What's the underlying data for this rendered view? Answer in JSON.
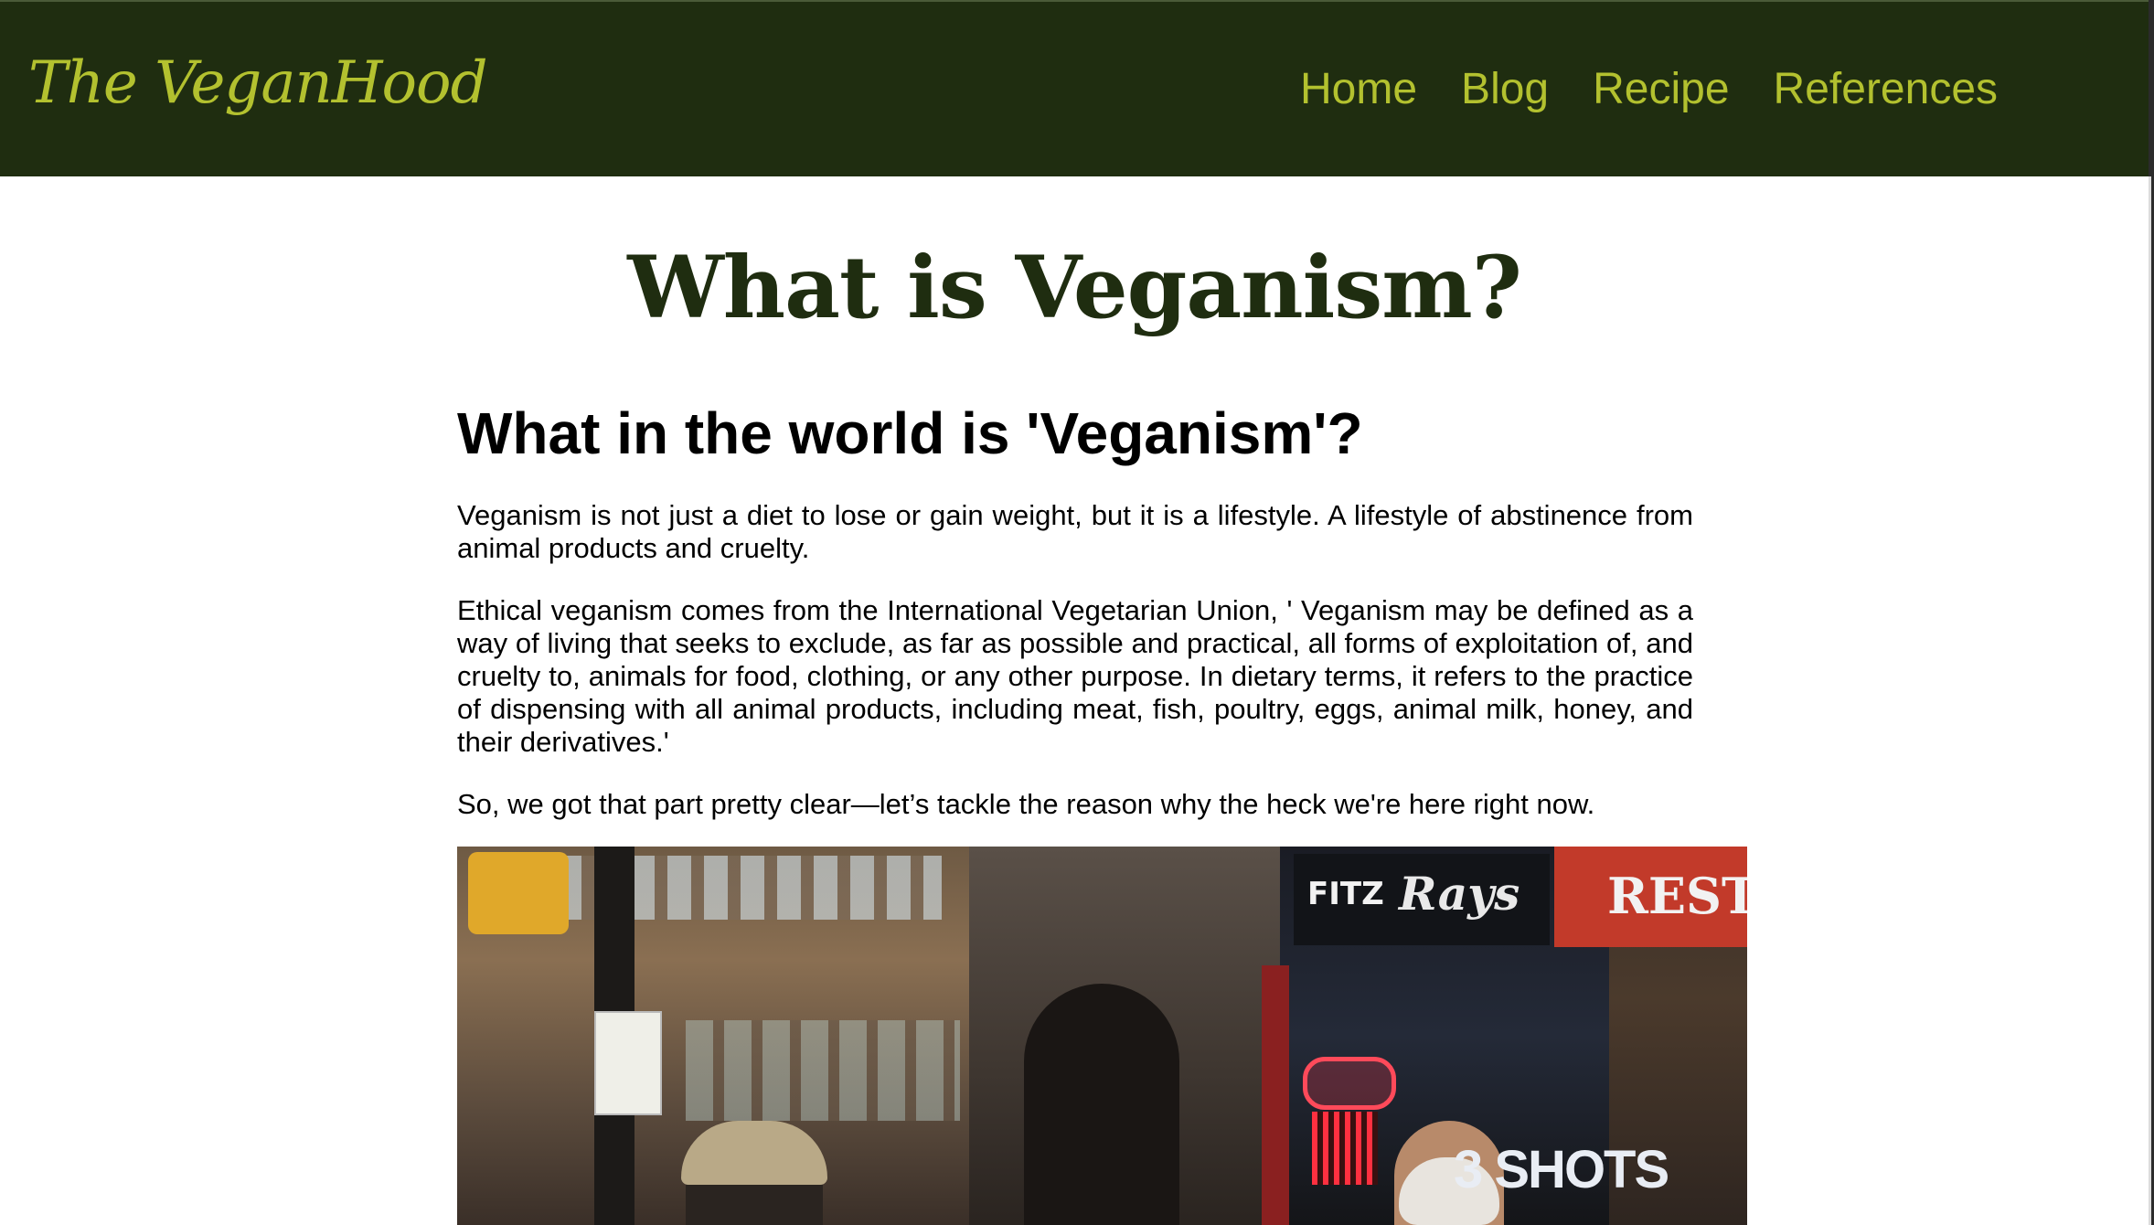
{
  "site": {
    "brand": "The VeganHood"
  },
  "nav": {
    "items": [
      {
        "label": "Home"
      },
      {
        "label": "Blog"
      },
      {
        "label": "Recipe"
      },
      {
        "label": "References"
      }
    ]
  },
  "main": {
    "title": "What is Veganism?",
    "heading": "What in the world is 'Veganism'?",
    "paragraphs": [
      "Veganism is not just a diet to lose or gain weight, but it is a lifestyle. A lifestyle of abstinence from animal products and cruelty.",
      "Ethical veganism comes from the International Vegetarian Union, ' Veganism may be defined as a way of living that seeks to exclude, as far as possible and practical, all forms of exploitation of, and cruelty to, animals for food, clothing, or any other purpose. In dietary terms, it refers to the practice of dispensing with all animal products, including meat, fish, poultry, eggs, animal milk, honey, and their derivatives.'",
      "So, we got that part pretty clear—let’s tackle the reason why the heck we're here right now."
    ]
  },
  "photo": {
    "signs": {
      "fitz": "FITZ",
      "rays": "Rays",
      "restau": "RESTAU",
      "shots": "3 SHOTS"
    }
  },
  "colors": {
    "header_bg": "#1f2d10",
    "accent": "#b3c12f",
    "title": "#1f2d10",
    "text": "#000000"
  }
}
